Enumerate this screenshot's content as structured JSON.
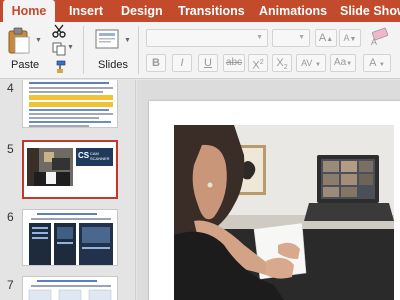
{
  "ribbon_tabs": [
    "Home",
    "Insert",
    "Design",
    "Transitions",
    "Animations",
    "Slide Show"
  ],
  "active_tab": "Home",
  "ribbon": {
    "paste_label": "Paste",
    "slides_label": "Slides",
    "text_buttons": {
      "increase_font": "A",
      "decrease_font": "A",
      "strikethrough": "abc",
      "superscript": "X",
      "superscript_mark": "2",
      "subscript": "X",
      "subscript_mark": "2",
      "char_spacing": "AV",
      "change_case": "Aa",
      "font_color": "A"
    }
  },
  "thumbnails": [
    {
      "number": "4"
    },
    {
      "number": "5",
      "selected": true,
      "logo_text": "CS",
      "logo_sub": "CAM SCANNER"
    },
    {
      "number": "6"
    },
    {
      "number": "7"
    }
  ],
  "colors": {
    "ribbon_tab_bg": "#c34a2b",
    "selection_border": "#c0392b",
    "ribbon_bg": "#f3f3f3"
  }
}
